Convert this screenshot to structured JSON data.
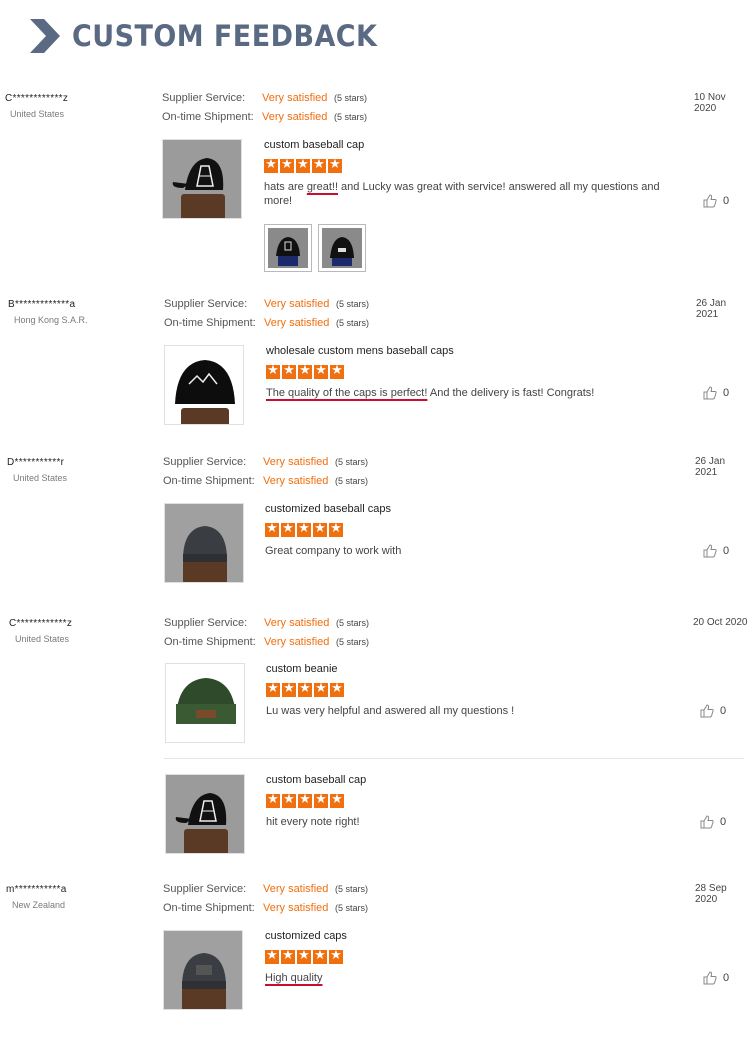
{
  "header": {
    "title": "CUSTOM FEEDBACK",
    "icon": "chevron-right-icon",
    "title_color": "#5a6a82"
  },
  "labels": {
    "supplier_service": "Supplier Service:",
    "ontime_shipment": "On-time Shipment:"
  },
  "colors": {
    "accent": "#f06f0f",
    "underline": "#c8102e"
  },
  "reviews": [
    {
      "user": "C************z",
      "country": "United States",
      "date": "10 Nov 2020",
      "supplier_value": "Very satisfied",
      "supplier_stars": "(5 stars)",
      "shipment_value": "Very satisfied",
      "shipment_stars": "(5 stars)",
      "products": [
        {
          "title": "custom baseball cap",
          "rating": 5,
          "comment_pre": "hats are ",
          "comment_ul": "great!!",
          "comment_post": " and Lucky was great with service! answered all my questions and more!",
          "likes": "0"
        }
      ]
    },
    {
      "user": "B*************a",
      "country": "Hong Kong S.A.R.",
      "date": "26 Jan 2021",
      "supplier_value": "Very satisfied",
      "supplier_stars": "(5 stars)",
      "shipment_value": "Very satisfied",
      "shipment_stars": "(5 stars)",
      "products": [
        {
          "title": "wholesale custom mens baseball caps",
          "rating": 5,
          "comment_pre": "",
          "comment_ul": "The quality of the caps is perfect!",
          "comment_post": " And the delivery is fast! Congrats!",
          "likes": "0"
        }
      ]
    },
    {
      "user": "D***********r",
      "country": "United States",
      "date": "26 Jan 2021",
      "supplier_value": "Very satisfied",
      "supplier_stars": "(5 stars)",
      "shipment_value": "Very satisfied",
      "shipment_stars": "(5 stars)",
      "products": [
        {
          "title": "customized baseball caps",
          "rating": 5,
          "comment_pre": "Great company to work with",
          "comment_ul": "",
          "comment_post": "",
          "likes": "0"
        }
      ]
    },
    {
      "user": "C************z",
      "country": "United States",
      "date": "20 Oct 2020",
      "supplier_value": "Very satisfied",
      "supplier_stars": "(5 stars)",
      "shipment_value": "Very satisfied",
      "shipment_stars": "(5 stars)",
      "products": [
        {
          "title": "custom beanie",
          "rating": 5,
          "comment_pre": "Lu was very helpful and aswered all my questions !",
          "comment_ul": "",
          "comment_post": "",
          "likes": "0"
        },
        {
          "title": "custom baseball cap",
          "rating": 5,
          "comment_pre": "hit every note right!",
          "comment_ul": "",
          "comment_post": "",
          "likes": "0"
        }
      ]
    },
    {
      "user": "m***********a",
      "country": "New Zealand",
      "date": "28 Sep 2020",
      "supplier_value": "Very satisfied",
      "supplier_stars": "(5 stars)",
      "shipment_value": "Very satisfied",
      "shipment_stars": "(5 stars)",
      "products": [
        {
          "title": "customized caps",
          "rating": 5,
          "comment_pre": "",
          "comment_ul": "High quality",
          "comment_post": "",
          "likes": "0"
        }
      ]
    }
  ]
}
